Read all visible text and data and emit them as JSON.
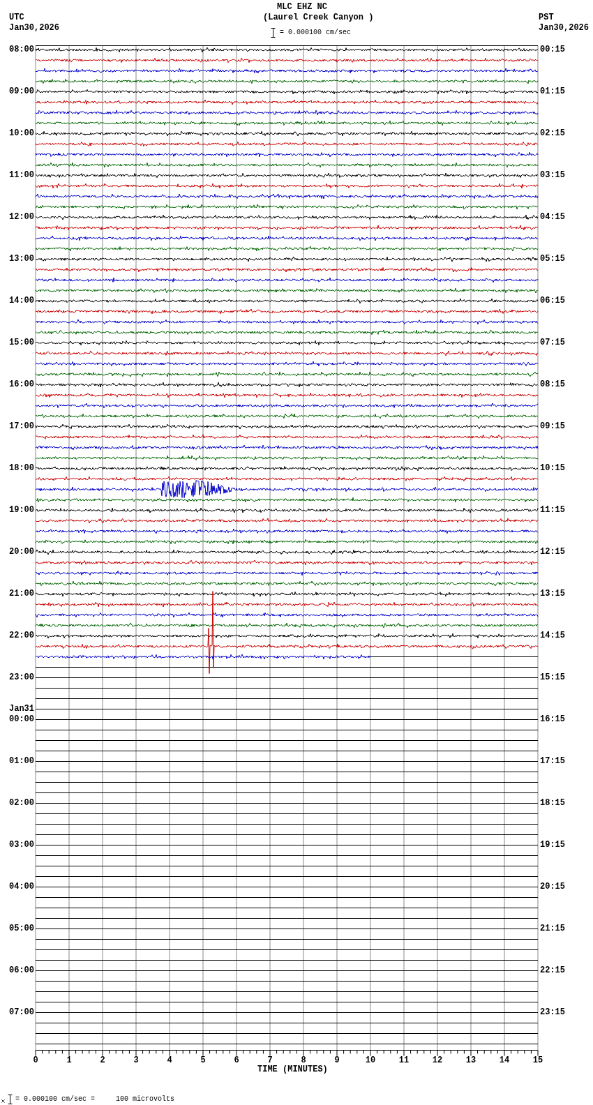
{
  "header": {
    "station": "MLC EHZ NC",
    "location": "(Laurel Creek Canyon )",
    "scale": "= 0.000100 cm/sec"
  },
  "left_heading": {
    "zone": "UTC",
    "date": "Jan30,2026"
  },
  "right_heading": {
    "zone": "PST",
    "date": "Jan30,2026"
  },
  "utc_hours": [
    {
      "time": "08:00"
    },
    {
      "time": "09:00"
    },
    {
      "time": "10:00"
    },
    {
      "time": "11:00"
    },
    {
      "time": "12:00"
    },
    {
      "time": "13:00"
    },
    {
      "time": "14:00"
    },
    {
      "time": "15:00"
    },
    {
      "time": "16:00"
    },
    {
      "time": "17:00"
    },
    {
      "time": "18:00"
    },
    {
      "time": "19:00"
    },
    {
      "time": "20:00"
    },
    {
      "time": "21:00"
    },
    {
      "time": "22:00"
    },
    {
      "time": "23:00"
    },
    {
      "time": "00:00",
      "date": "Jan31"
    },
    {
      "time": "01:00"
    },
    {
      "time": "02:00"
    },
    {
      "time": "03:00"
    },
    {
      "time": "04:00"
    },
    {
      "time": "05:00"
    },
    {
      "time": "06:00"
    },
    {
      "time": "07:00"
    }
  ],
  "pst_hours": [
    "00:15",
    "01:15",
    "02:15",
    "03:15",
    "04:15",
    "05:15",
    "06:15",
    "07:15",
    "08:15",
    "09:15",
    "10:15",
    "11:15",
    "12:15",
    "13:15",
    "14:15",
    "15:15",
    "16:15",
    "17:15",
    "18:15",
    "19:15",
    "20:15",
    "21:15",
    "22:15",
    "23:15"
  ],
  "x_axis": {
    "ticks": [
      "0",
      "1",
      "2",
      "3",
      "4",
      "5",
      "6",
      "7",
      "8",
      "9",
      "10",
      "11",
      "12",
      "13",
      "14",
      "15"
    ],
    "title": "TIME (MINUTES)"
  },
  "footer": {
    "text": "= 0.000100 cm/sec =     100 microvolts"
  }
}
